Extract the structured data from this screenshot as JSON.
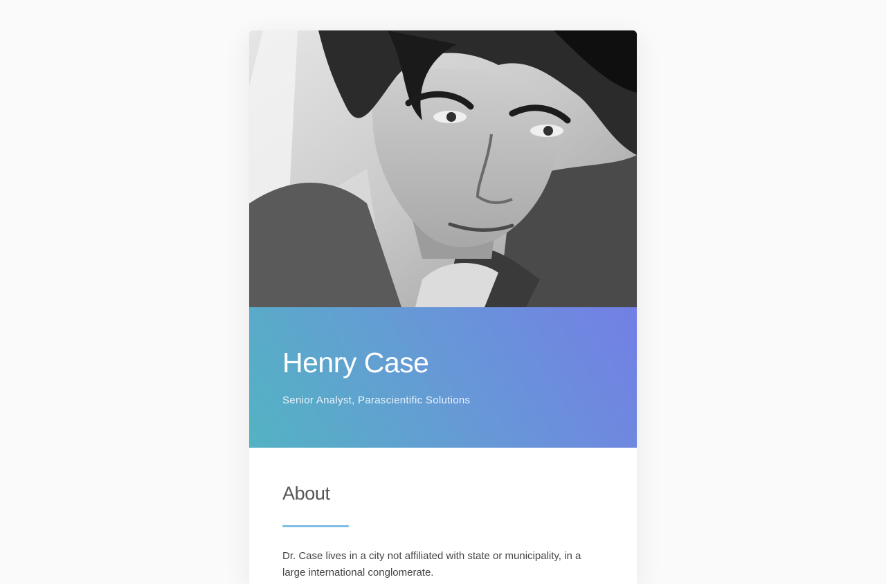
{
  "profile": {
    "photo": "portrait-photo",
    "name": "Henry Case",
    "title": "Senior Analyst, Parascientific Solutions"
  },
  "about": {
    "heading": "About",
    "body": "Dr. Case lives in a city not affiliated with state or municipality, in a large international conglomerate."
  },
  "colors": {
    "page_background": "#fafafa",
    "card_background": "#ffffff",
    "hero_gradient_start": "#53b3c3",
    "hero_gradient_mid": "#6699d6",
    "hero_gradient_end": "#737fe5",
    "accent_rule": "#7fbfe6",
    "heading_text": "#555555"
  }
}
